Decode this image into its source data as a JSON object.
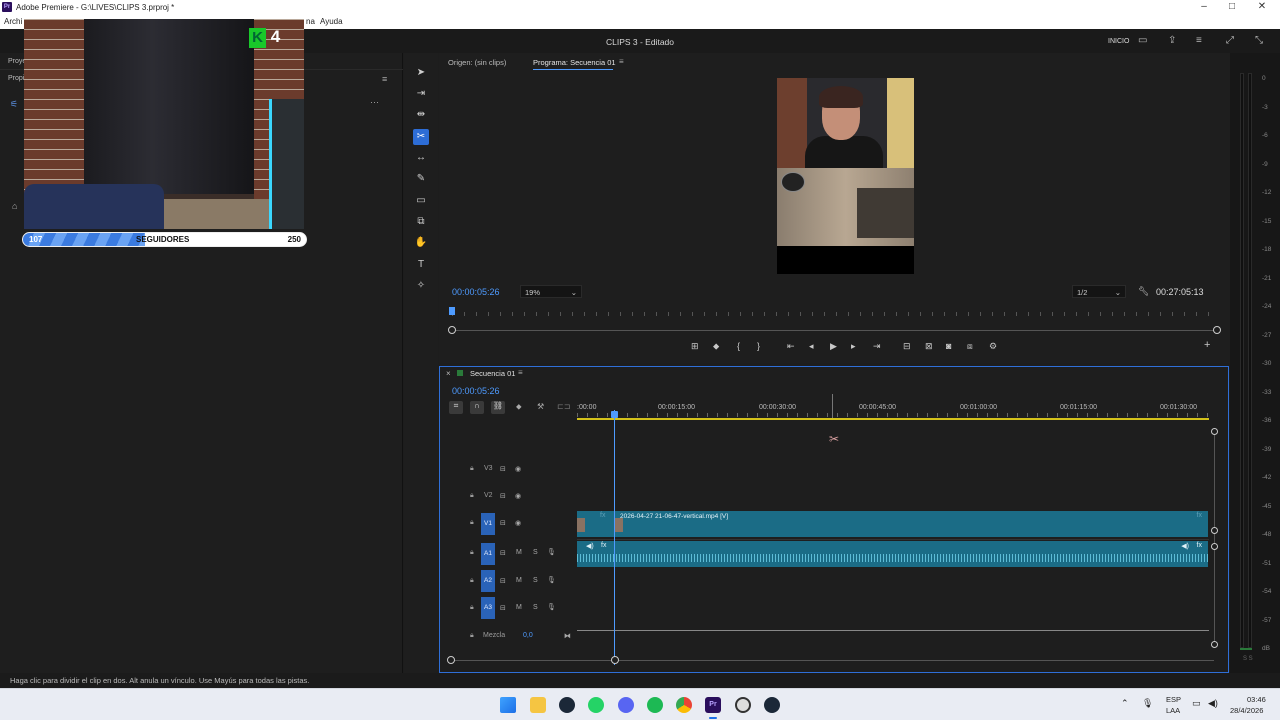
{
  "window": {
    "title": "Adobe Premiere - G:\\LIVES\\CLIPS 3.prproj *",
    "app_badge": "Pr",
    "menu": [
      "Archi",
      "na",
      "Ayuda"
    ]
  },
  "header": {
    "project_title": "CLIPS 3 - Editado",
    "workspace": "INICIO"
  },
  "left_panel": {
    "tab1": "Proye",
    "tab2": "Propi"
  },
  "overlay": {
    "kick_badge_letter": "K",
    "kick_badge_number": "4",
    "followers": {
      "current": "107",
      "label": "SEGUIDORES",
      "goal": "250",
      "progress_fraction": 0.43
    }
  },
  "monitor": {
    "source_tab": "Origen: (sin clips)",
    "program_tab": "Programa: Secuencia 01",
    "timecode": "00:00:05:26",
    "zoom": "19%",
    "resolution": "1/2",
    "duration": "00:27:05:13"
  },
  "timeline": {
    "sequence_name": "Secuencia 01",
    "timecode": "00:00:05:26",
    "ruler": [
      ":00:00",
      "00:00:15:00",
      "00:00:30:00",
      "00:00:45:00",
      "00:01:00:00",
      "00:01:15:00",
      "00:01:30:00"
    ],
    "tracks": {
      "v3": "V3",
      "v2": "V2",
      "v1": "V1",
      "a1": "A1",
      "a2": "A2",
      "a3": "A3",
      "mix_label": "Mezcla",
      "mix_value": "0,0"
    },
    "video_clip_name": "2026-04-27 21-06-47-vertical.mp4 [V]",
    "fx": "fx"
  },
  "vu_meter": {
    "labels": [
      "0",
      "-3",
      "-6",
      "-9",
      "-12",
      "-15",
      "-18",
      "-21",
      "-24",
      "-27",
      "-30",
      "-33",
      "-36",
      "-39",
      "-42",
      "-45",
      "-48",
      "-51",
      "-54",
      "-57",
      "dB"
    ],
    "footer": "S S"
  },
  "status": {
    "message": "Haga clic para dividir el clip en dos. Alt anula un vínculo. Use Mayús para todas las pistas."
  },
  "taskbar": {
    "lang_top": "ESP",
    "lang_bottom": "LAA",
    "time": "03:46",
    "date": "28/4/2026"
  },
  "colors": {
    "accent_blue": "#2d6dd6",
    "clip_teal": "#1b6c86",
    "track_target": "#2a63b8",
    "timecode_blue": "#4e9bff",
    "kick_green": "#19c82a"
  }
}
